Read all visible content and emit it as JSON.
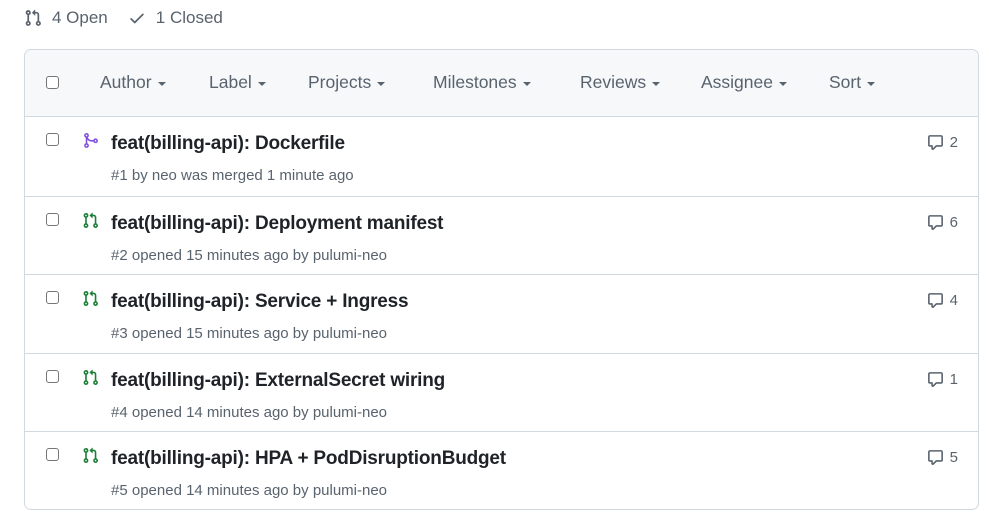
{
  "states": {
    "open_label": "4 Open",
    "closed_label": "1 Closed"
  },
  "filters": {
    "author": "Author",
    "label": "Label",
    "projects": "Projects",
    "milestones": "Milestones",
    "reviews": "Reviews",
    "assignee": "Assignee",
    "sort": "Sort"
  },
  "colors": {
    "open_green": "#1a7f37",
    "merged_purple": "#8250df",
    "muted": "#59636e"
  },
  "pulls": [
    {
      "title": "feat(billing-api): Dockerfile",
      "meta": "#1 by neo was merged 1 minute ago",
      "comments": "2",
      "state": "merged",
      "icon": "git-merge-icon"
    },
    {
      "title": "feat(billing-api): Deployment manifest",
      "meta": "#2 opened 15 minutes ago by pulumi-neo",
      "comments": "6",
      "state": "open",
      "icon": "git-pull-request-icon"
    },
    {
      "title": "feat(billing-api): Service + Ingress",
      "meta": "#3 opened 15 minutes ago by pulumi-neo",
      "comments": "4",
      "state": "open",
      "icon": "git-pull-request-icon"
    },
    {
      "title": "feat(billing-api): ExternalSecret wiring",
      "meta": "#4 opened 14 minutes ago by pulumi-neo",
      "comments": "1",
      "state": "open",
      "icon": "git-pull-request-icon"
    },
    {
      "title": "feat(billing-api): HPA + PodDisruptionBudget",
      "meta": "#5 opened 14 minutes ago by pulumi-neo",
      "comments": "5",
      "state": "open",
      "icon": "git-pull-request-icon"
    }
  ]
}
